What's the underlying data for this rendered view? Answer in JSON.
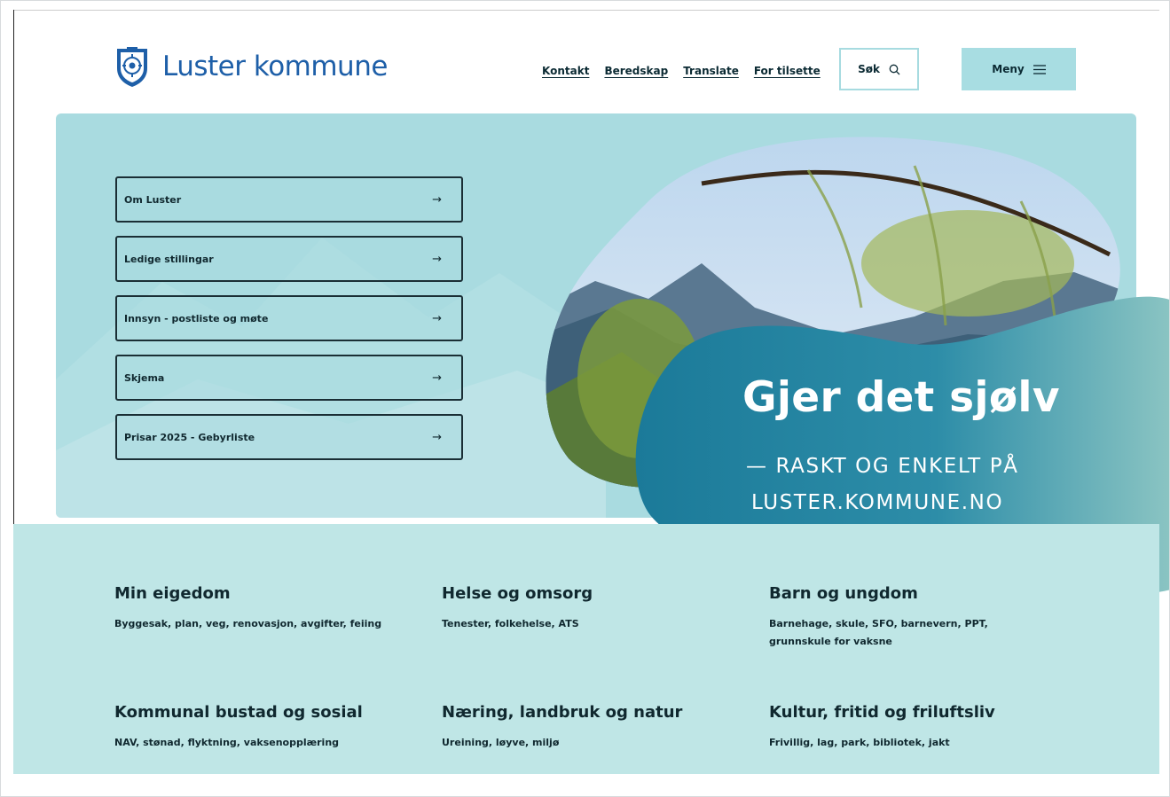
{
  "header": {
    "logo_text": "Luster kommune",
    "nav": [
      "Kontakt",
      "Beredskap",
      "Translate",
      "For tilsette"
    ],
    "search_label": "Søk",
    "menu_label": "Meny"
  },
  "quicklinks": [
    {
      "label": "Om Luster"
    },
    {
      "label": "Ledige stillingar"
    },
    {
      "label": "Innsyn - postliste og møte"
    },
    {
      "label": "Skjema"
    },
    {
      "label": "Prisar 2025 - Gebyrliste"
    }
  ],
  "promo": {
    "title": "Gjer det sjølv",
    "line1": "— RASKT OG ENKELT PÅ",
    "line2": "LUSTER.KOMMUNE.NO"
  },
  "categories": [
    {
      "title": "Min eigedom",
      "desc": "Byggesak, plan, veg, renovasjon, avgifter, feiing"
    },
    {
      "title": "Helse og omsorg",
      "desc": "Tenester, folkehelse, ATS"
    },
    {
      "title": "Barn og ungdom",
      "desc": "Barnehage, skule, SFO, barnevern, PPT, grunnskule for vaksne"
    },
    {
      "title": "Kommunal bustad og sosial",
      "desc": "NAV, stønad, flyktning, vaksenopplæring"
    },
    {
      "title": "Næring, landbruk og natur",
      "desc": "Ureining, løyve, miljø"
    },
    {
      "title": "Kultur, fritid og friluftsliv",
      "desc": "Frivillig, lag, park, bibliotek, jakt"
    }
  ],
  "icons": {
    "logo": "coat-of-arms-icon",
    "search": "search-icon",
    "menu": "hamburger-icon",
    "arrow": "arrow-right-icon"
  },
  "colors": {
    "brand_blue": "#1e5fa8",
    "hero_bg": "#a9dbe0",
    "category_bg": "#bfe6e6",
    "promo_teal": "#1f8aa0"
  }
}
